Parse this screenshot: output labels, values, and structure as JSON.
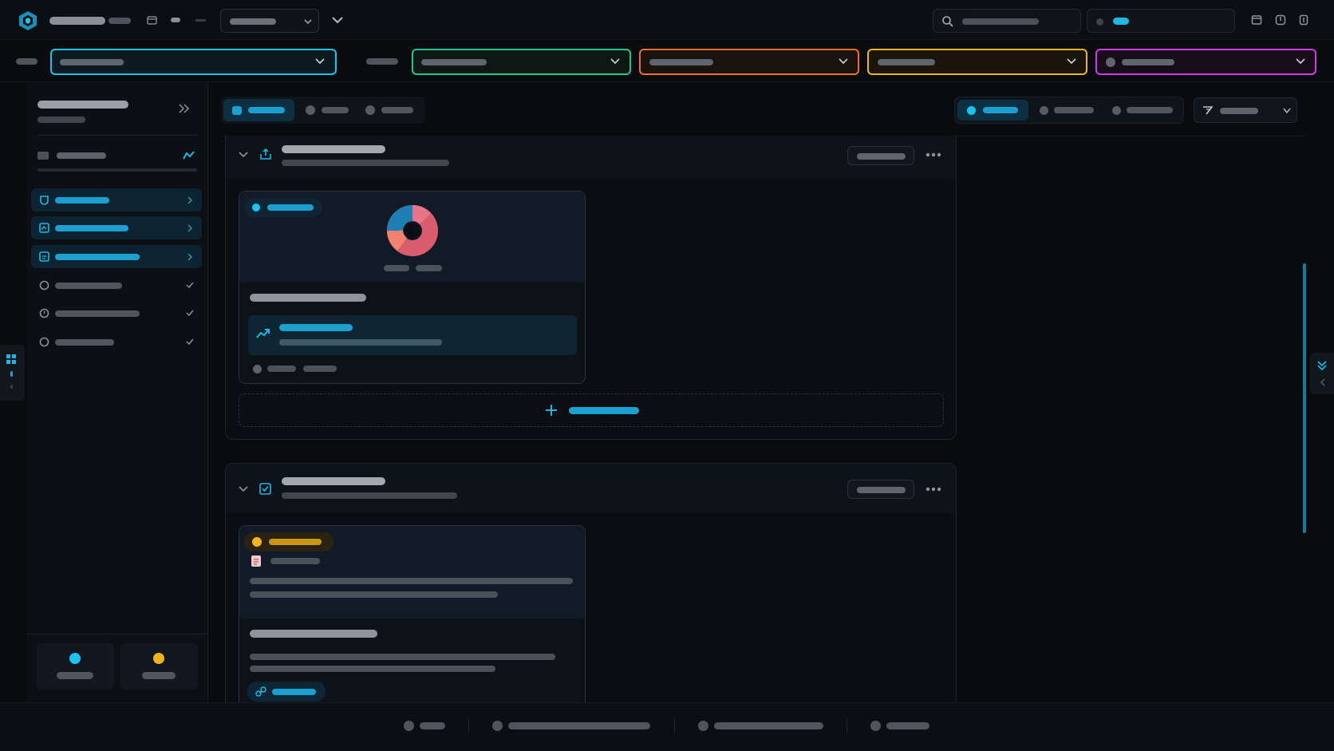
{
  "colors": {
    "background": "#090b0e",
    "panel": "#0e1218",
    "card": "#111722",
    "accent_cyan": "#19c4f0",
    "accent_green": "#1fc58a",
    "accent_orange": "#f0702a",
    "accent_yellow": "#f0b51e",
    "accent_magenta": "#cf3ae6"
  },
  "icons": {
    "logo": "hexagon-logo-icon",
    "search": "search-icon",
    "chevron": "chevron-down-icon",
    "collapse": "double-chevron-right-icon",
    "add": "plus-icon",
    "more": "more-dots-icon",
    "trend": "trend-up-icon",
    "link": "link-icon",
    "check": "checkbox-icon",
    "upload": "upload-icon"
  },
  "sidebar": {
    "nav_state": [
      "active",
      "active",
      "active",
      "done",
      "done",
      "done"
    ]
  },
  "status": {
    "left_dot": "#19c4f0",
    "right_dot": "#f0b51e"
  }
}
